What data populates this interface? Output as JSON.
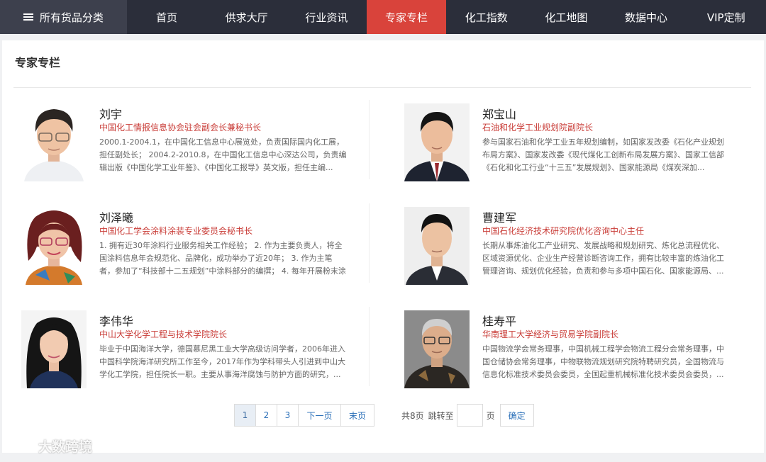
{
  "nav": {
    "category_label": "所有货品分类",
    "items": [
      {
        "label": "首页",
        "active": false
      },
      {
        "label": "供求大厅",
        "active": false
      },
      {
        "label": "行业资讯",
        "active": false
      },
      {
        "label": "专家专栏",
        "active": true
      },
      {
        "label": "化工指数",
        "active": false
      },
      {
        "label": "化工地图",
        "active": false
      },
      {
        "label": "数据中心",
        "active": false
      },
      {
        "label": "VIP定制",
        "active": false
      }
    ]
  },
  "panel": {
    "title": "专家专栏"
  },
  "experts": [
    {
      "name": "刘宇",
      "title": "中国化工情报信息协会驻会副会长兼秘书长",
      "desc": "2000.1-2004.1，在中国化工信息中心展览处，负责国际国内化工展，担任副处长； 2004.2-2010.8，在中国化工信息中心深达公司，负责编辑出版《中国化学工业年鉴》、《中国化工报导》英文版，担任主编..."
    },
    {
      "name": "郑宝山",
      "title": "石油和化学工业规划院副院长",
      "desc": "参与国家石油和化学工业五年规划编制，如国家发改委《石化产业规划布局方案》、国家发改委《现代煤化工创新布局发展方案》、国家工信部《石化和化工行业“十三五”发展规划》、国家能源局《煤炭深加..."
    },
    {
      "name": "刘泽曦",
      "title": "中国化工学会涂料涂装专业委员会秘书长",
      "desc": "1. 拥有近30年涂料行业服务相关工作经验； 2. 作为主要负责人，将全国涂料信息年会规范化、品牌化，成功举办了近20年； 3. 作为主笔者，参加了“科技部十二五规划”中涂料部分的编撰； 4. 每年开展粉末涂料..."
    },
    {
      "name": "曹建军",
      "title": "中国石化经济技术研究院优化咨询中心主任",
      "desc": "长期从事炼油化工产业研究、发展战略和规划研究、炼化总流程优化、区域资源优化、企业生产经营诊断咨询工作，拥有比较丰富的炼油化工管理咨询、规划优化经验，负责和参与多项中国石化、国家能源局、..."
    },
    {
      "name": "李伟华",
      "title": "中山大学化学工程与技术学院院长",
      "desc": "毕业于中国海洋大学，德国慕尼黑工业大学高级访问学者，2006年进入中国科学院海洋研究所工作至今，2017年作为学科带头人引进到中山大学化工学院，担任院长一职。主要从事海洋腐蚀与防护方面的研究，..."
    },
    {
      "name": "桂寿平",
      "title": "华南理工大学经济与贸易学院副院长",
      "desc": "中国物流学会常务理事，中国机械工程学会物流工程分会常务理事，中国仓储协会常务理事，中物联物流规划研究院特聘研究员，全国物流与信息化标准技术委员会委员，全国起重机械标准化技术委员会委员，..."
    }
  ],
  "pagination": {
    "pages": [
      "1",
      "2",
      "3"
    ],
    "current": "1",
    "next_label": "下一页",
    "last_label": "末页",
    "total_label": "共8页",
    "jump_label": "跳转至",
    "page_unit": "页",
    "confirm_label": "确定",
    "jump_value": ""
  },
  "watermark": {
    "text": "大数跨境"
  }
}
